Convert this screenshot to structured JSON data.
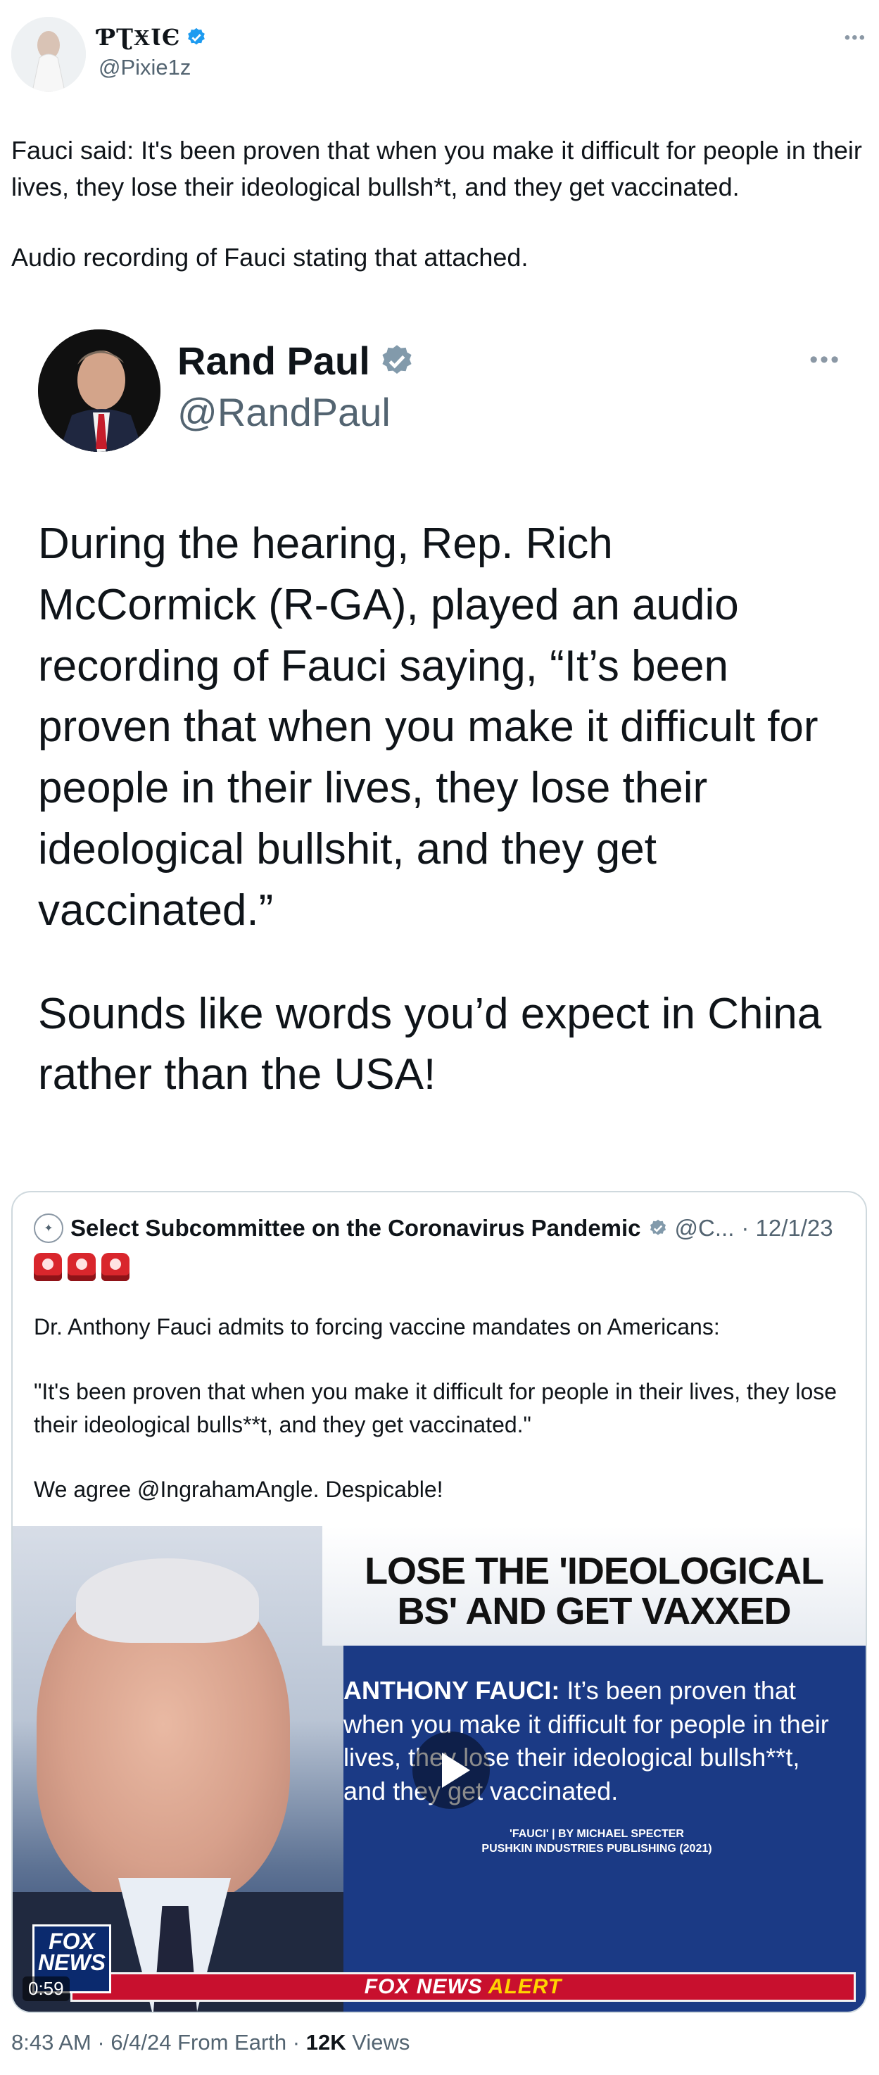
{
  "author": {
    "display_name": "ƤƮӾƖЄ",
    "handle": "@Pixie1z",
    "verified": true
  },
  "tweet": {
    "paragraphs": [
      "Fauci said:  It's been proven that when you make it difficult for people in their lives, they lose their ideological bullsh*t, and they get vaccinated.",
      "Audio recording of Fauci stating that attached."
    ]
  },
  "embedded_tweet": {
    "display_name": "Rand Paul",
    "handle": "@RandPaul",
    "verified": true,
    "paragraphs": [
      "During the hearing, Rep. Rich McCormick (R-GA), played an audio recording of Fauci saying, “It’s been proven that when you make it difficult for people in their lives, they lose their ideological bullshit, and they get vaccinated.”",
      "Sounds like words you’d expect in China rather than the USA!"
    ]
  },
  "quote": {
    "display_name": "Select Subcommittee on the Coronavirus Pandemic",
    "handle": "@C...",
    "date": "· 12/1/23",
    "emoji": [
      "🚨",
      "🚨",
      "🚨"
    ],
    "paragraphs": [
      "Dr. Anthony Fauci admits to forcing vaccine mandates on Americans:",
      "\"It's been proven that when you make it difficult for people in their lives, they lose their ideological bulls**t, and they get vaccinated.\"",
      "We agree @IngrahamAngle. Despicable!"
    ],
    "video": {
      "banner_line1": "LOSE THE 'IDEOLOGICAL",
      "banner_line2": "BS' AND GET VAXXED",
      "quote_speaker": "ANTHONY FAUCI:",
      "quote_text": "It’s been proven that when you make it difficult for people in their lives, they lose their ideological bullsh**t, and they get vaccinated.",
      "credit_line1": "'FAUCI' | BY MICHAEL SPECTER",
      "credit_line2": "PUSHKIN INDUSTRIES PUBLISHING (2021)",
      "alert_fox_news": "FOX NEWS",
      "alert_word": "ALERT",
      "logo_line1": "FOX",
      "logo_line2": "NEWS",
      "duration": "0:59"
    }
  },
  "footer": {
    "time": "8:43 AM",
    "sep1": " · ",
    "date": "6/4/24 From Earth",
    "sep2": " · ",
    "views_count": "12K",
    "views_label": " Views"
  },
  "colors": {
    "verified_blue": "#1d9bf0",
    "verified_gray": "#829aab",
    "muted_text": "#536471",
    "card_border": "#cfd9de",
    "alert_red": "#c8102e"
  }
}
